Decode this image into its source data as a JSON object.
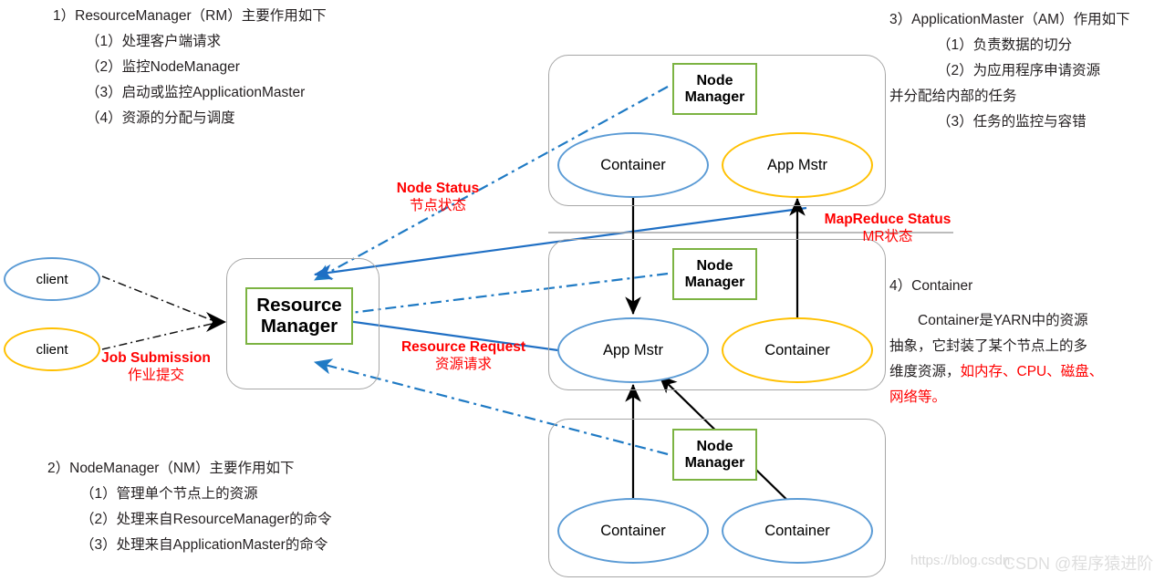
{
  "colors": {
    "green_border": "#7cb342",
    "blue_ellipse": "#5b9bd5",
    "gold_ellipse": "#ffc000",
    "cluster_border": "#a6a6a6",
    "red_text": "#ff0000",
    "blue_arrow": "#1f6fc4",
    "dash_arrow": "#1f7ac4",
    "black_arrow": "#000000",
    "text": "#231f20"
  },
  "notes": {
    "rm": {
      "heading": "1）ResourceManager（RM）主要作用如下",
      "items": [
        "（1）处理客户端请求",
        "（2）监控NodeManager",
        "（3）启动或监控ApplicationMaster",
        "（4）资源的分配与调度"
      ]
    },
    "nm": {
      "heading": "2）NodeManager（NM）主要作用如下",
      "items": [
        "（1）管理单个节点上的资源",
        "（2）处理来自ResourceManager的命令",
        "（3）处理来自ApplicationMaster的命令"
      ]
    },
    "am": {
      "heading": "3）ApplicationMaster（AM）作用如下",
      "items": [
        "（1）负责数据的切分",
        "（2）为应用程序申请资源"
      ],
      "continuation": "并分配给内部的任务",
      "items_after": [
        "（3）任务的监控与容错"
      ]
    },
    "container": {
      "heading": "4）Container",
      "paragraph_lines": [
        "　　Container是YARN中的资源",
        "抽象，它封装了某个节点上的多"
      ],
      "line3_black": "维度资源，",
      "line3_red": "如内存、CPU、磁盘、",
      "line4_red": "网络等。"
    }
  },
  "nodes": {
    "resource_manager": "Resource\nManager",
    "resource_manager_line1": "Resource",
    "resource_manager_line2": "Manager",
    "node_manager_line1": "Node",
    "node_manager_line2": "Manager",
    "client_top": "client",
    "client_bottom": "client",
    "container": "Container",
    "app_mstr": "App Mstr"
  },
  "clusters": [
    {
      "id": "cluster-top",
      "node_manager": [
        "Node",
        "Manager"
      ],
      "left_ellipse": {
        "label": "Container",
        "color": "blue"
      },
      "right_ellipse": {
        "label": "App Mstr",
        "color": "gold"
      }
    },
    {
      "id": "cluster-middle",
      "node_manager": [
        "Node",
        "Manager"
      ],
      "left_ellipse": {
        "label": "App Mstr",
        "color": "blue"
      },
      "right_ellipse": {
        "label": "Container",
        "color": "gold"
      }
    },
    {
      "id": "cluster-bottom",
      "node_manager": [
        "Node",
        "Manager"
      ],
      "left_ellipse": {
        "label": "Container",
        "color": "blue"
      },
      "right_ellipse": {
        "label": "Container",
        "color": "blue"
      }
    }
  ],
  "captions": {
    "node_status": {
      "en": "Node Status",
      "zh": "节点状态"
    },
    "job_submission": {
      "en": "Job Submission",
      "zh": "作业提交"
    },
    "resource_request": {
      "en": "Resource Request",
      "zh": "资源请求"
    },
    "mapreduce_status": {
      "en": "MapReduce Status",
      "zh": "MR状态"
    }
  },
  "watermark": {
    "url": "https://blog.csdn.",
    "brand": "CSDN @程序猿进阶"
  }
}
